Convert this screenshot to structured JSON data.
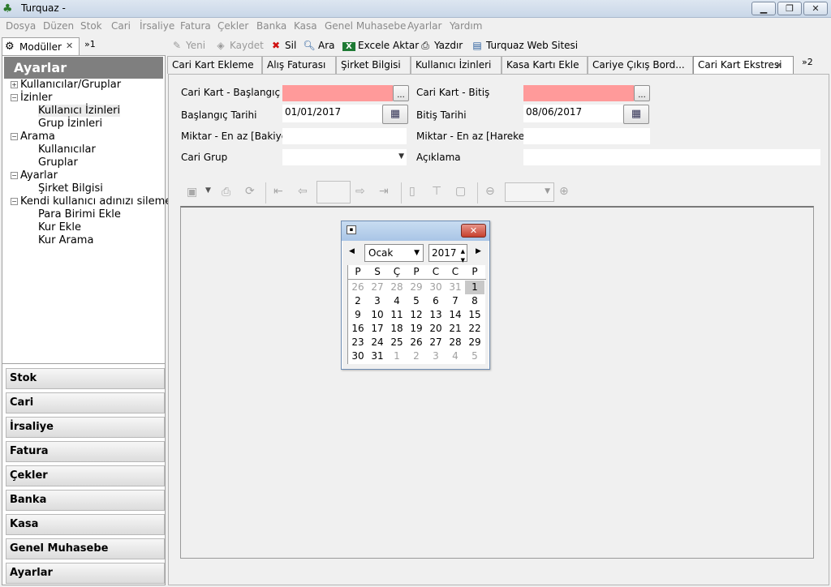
{
  "window": {
    "title": "Turquaz -"
  },
  "menu": [
    "Dosya",
    "Düzen",
    "Stok",
    "Cari",
    "İrsaliye",
    "Fatura",
    "Çekler",
    "Banka",
    "Kasa",
    "Genel Muhasebe",
    "Ayarlar",
    "Yardım"
  ],
  "module_tab": {
    "label": "Modüller",
    "overflow": "1"
  },
  "left_panel": {
    "header": "Ayarlar",
    "tree": [
      {
        "label": "Kullanıcılar/Gruplar",
        "level": 0,
        "expander": "+"
      },
      {
        "label": "İzinler",
        "level": 0,
        "expander": "−"
      },
      {
        "label": "Kullanıcı İzinleri",
        "level": 1,
        "selected": true
      },
      {
        "label": "Grup İzinleri",
        "level": 1
      },
      {
        "label": "Arama",
        "level": 0,
        "expander": "−"
      },
      {
        "label": "Kullanıcılar",
        "level": 1
      },
      {
        "label": "Gruplar",
        "level": 1
      },
      {
        "label": "Ayarlar",
        "level": 0,
        "expander": "−"
      },
      {
        "label": "Şirket Bilgisi",
        "level": 1
      },
      {
        "label": "Kendi kullanıcı adınızı sileme",
        "level": 0,
        "expander": "−"
      },
      {
        "label": "Para Birimi Ekle",
        "level": 1
      },
      {
        "label": "Kur Ekle",
        "level": 1
      },
      {
        "label": "Kur Arama",
        "level": 1
      }
    ],
    "accordion": [
      "Stok",
      "Cari",
      "İrsaliye",
      "Fatura",
      "Çekler",
      "Banka",
      "Kasa",
      "Genel Muhasebe",
      "Ayarlar"
    ]
  },
  "toolbar": {
    "new": "Yeni",
    "save": "Kaydet",
    "delete": "Sil",
    "search": "Ara",
    "excel": "Excele Aktar",
    "print": "Yazdır",
    "website": "Turquaz Web Sitesi"
  },
  "tabs": [
    "Cari Kart Ekleme",
    "Alış Faturası",
    "Şirket Bilgisi",
    "Kullanıcı İzinleri",
    "Kasa Kartı Ekle",
    "Cariye Çıkış Bord...",
    "Cari Kart Ekstresi"
  ],
  "tabs_overflow": "2",
  "form": {
    "cari_start_label": "Cari Kart - Başlangıç",
    "cari_end_label": "Cari Kart - Bitiş",
    "start_date_label": "Başlangıç Tarihi",
    "start_date_value": "01/01/2017",
    "end_date_label": "Bitiş Tarihi",
    "end_date_value": "08/06/2017",
    "min_balance_label": "Miktar - En az [Bakiye]",
    "min_movement_label": "Miktar - En az [Hareket]",
    "group_label": "Cari Grup",
    "description_label": "Açıklama",
    "browse": "..."
  },
  "calendar": {
    "month": "Ocak",
    "year": "2017",
    "weekdays": [
      "P",
      "S",
      "Ç",
      "P",
      "C",
      "C",
      "P"
    ],
    "weeks": [
      [
        "26",
        "27",
        "28",
        "29",
        "30",
        "31",
        "1"
      ],
      [
        "2",
        "3",
        "4",
        "5",
        "6",
        "7",
        "8"
      ],
      [
        "9",
        "10",
        "11",
        "12",
        "13",
        "14",
        "15"
      ],
      [
        "16",
        "17",
        "18",
        "19",
        "20",
        "21",
        "22"
      ],
      [
        "23",
        "24",
        "25",
        "26",
        "27",
        "28",
        "29"
      ],
      [
        "30",
        "31",
        "1",
        "2",
        "3",
        "4",
        "5"
      ]
    ],
    "selected_day": "1"
  }
}
